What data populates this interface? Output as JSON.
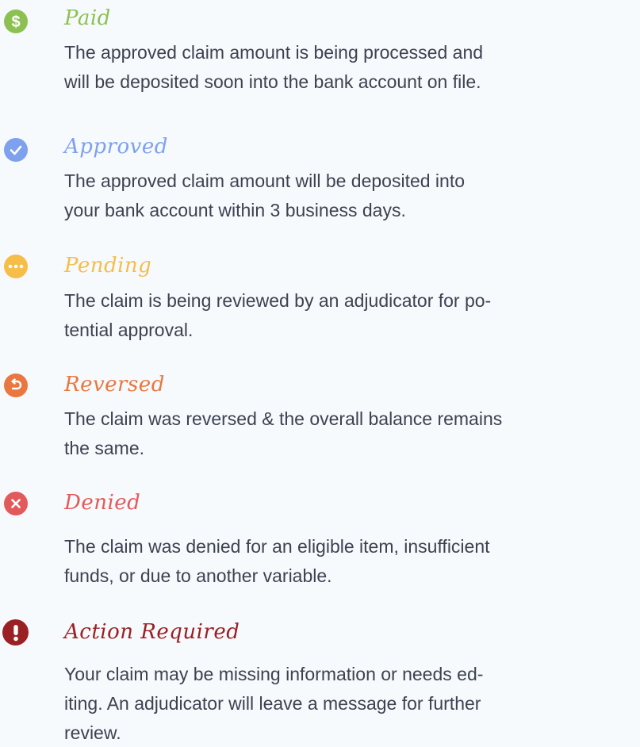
{
  "statuses": [
    {
      "title": "Paid",
      "description": "The approved claim amount is being processed and\nwill be deposited soon into the bank account on file.",
      "color": "#8cc152",
      "icon": "dollar-icon"
    },
    {
      "title": "Approved",
      "description": "The approved claim amount will be deposited into\nyour bank account within 3 business days.",
      "color": "#7ea1ee",
      "icon": "check-icon"
    },
    {
      "title": "Pending",
      "description": "The claim is being reviewed by an adjudicator for po-\ntential approval.",
      "color": "#f6bd48",
      "icon": "ellipsis-icon"
    },
    {
      "title": "Reversed",
      "description": "The claim was reversed & the overall balance remains\nthe same.",
      "color": "#e9773f",
      "icon": "undo-icon"
    },
    {
      "title": "Denied",
      "description": "The claim was denied for an eligible item, insufficient\nfunds, or due to another variable.",
      "color": "#e35a5a",
      "icon": "close-icon"
    },
    {
      "title": "Action Required",
      "description": "Your claim may be missing information or needs ed-\niting. An adjudicator will leave a message for further\nreview.",
      "color": "#9a2024",
      "icon": "exclamation-icon"
    }
  ]
}
